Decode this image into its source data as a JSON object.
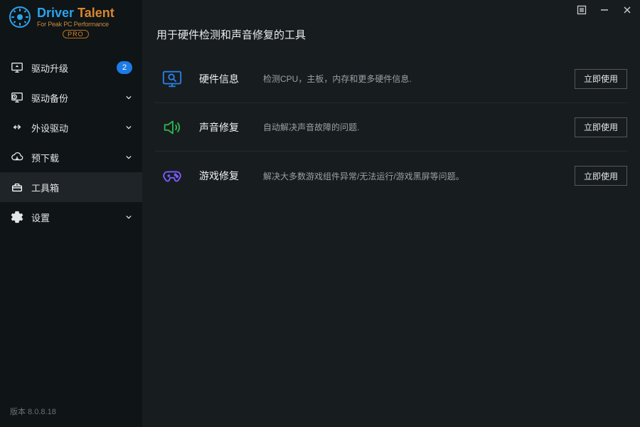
{
  "app": {
    "logo_primary_a": "Driver",
    "logo_primary_b": " Talent",
    "logo_sub": "For Peak PC Performance",
    "logo_pro": "PRO",
    "version_label": "版本 8.0.8.18"
  },
  "sidebar": {
    "items": [
      {
        "label": "驱动升级",
        "badge": "2"
      },
      {
        "label": "驱动备份"
      },
      {
        "label": "外设驱动"
      },
      {
        "label": "预下载"
      },
      {
        "label": "工具箱"
      },
      {
        "label": "设置"
      }
    ]
  },
  "main": {
    "heading": "用于硬件检测和声音修复的工具",
    "tools": [
      {
        "name": "硬件信息",
        "desc": "检测CPU，主板，内存和更多硬件信息.",
        "btn": "立即使用"
      },
      {
        "name": "声音修复",
        "desc": "自动解决声音故障的问题.",
        "btn": "立即使用"
      },
      {
        "name": "游戏修复",
        "desc": "解决大多数游戏组件异常/无法运行/游戏黑屏等问题。",
        "btn": "立即使用"
      }
    ]
  }
}
